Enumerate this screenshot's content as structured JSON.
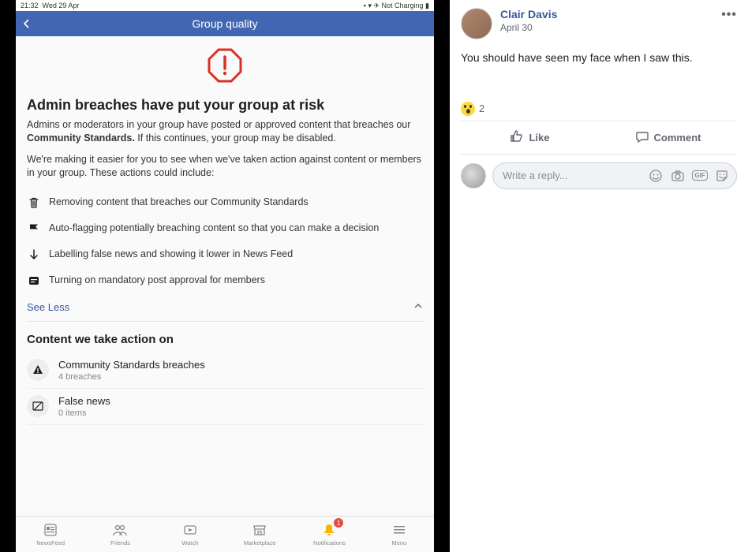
{
  "left": {
    "status": {
      "time": "21:32",
      "day": "Wed 29 Apr",
      "charge": "Not Charging"
    },
    "header": {
      "title": "Group quality"
    },
    "warning": {
      "h1": "Admin breaches have put your group at risk",
      "p1a": "Admins or moderators in your group have posted or approved content that breaches our ",
      "p1b": "Community Standards.",
      "p1c": " If this continues, your group may be disabled.",
      "p2": "We're making it easier for you to see when we've taken action against content or members in your group. These actions could include:"
    },
    "actions": [
      {
        "text": "Removing content that breaches our Community Standards"
      },
      {
        "text": "Auto-flagging potentially breaching content so that you can make a decision"
      },
      {
        "text": "Labelling false news and showing it lower in News Feed"
      },
      {
        "text": "Turning on mandatory post approval for members"
      }
    ],
    "see_less": "See Less",
    "section_h": "Content we take action on",
    "content_rows": [
      {
        "title": "Community Standards breaches",
        "sub": "4 breaches"
      },
      {
        "title": "False news",
        "sub": "0 items"
      }
    ],
    "tabs": [
      {
        "label": "NewsFeed"
      },
      {
        "label": "Friends"
      },
      {
        "label": "Watch"
      },
      {
        "label": "Marketplace"
      },
      {
        "label": "Notifications",
        "badge": "1"
      },
      {
        "label": "Menu"
      }
    ]
  },
  "post": {
    "author": "Clair Davis",
    "date": "April 30",
    "body": "You should have seen my face when I saw this.",
    "reaction_count": "2",
    "like_label": "Like",
    "comment_label": "Comment",
    "reply_placeholder": "Write a reply...",
    "gif_label": "GIF"
  }
}
